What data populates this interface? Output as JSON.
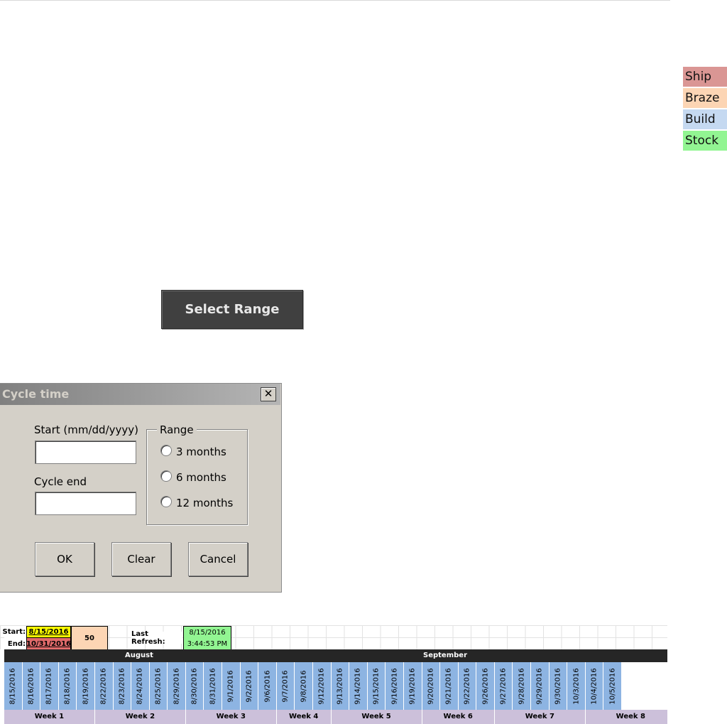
{
  "legend": {
    "items": [
      {
        "label": "Ship",
        "color": "#da9694"
      },
      {
        "label": "Braze",
        "color": "#fcd5b4"
      },
      {
        "label": "Build",
        "color": "#c5d9f1"
      },
      {
        "label": "Stock",
        "color": "#92f592"
      }
    ]
  },
  "select_range_button": {
    "label": "Select Range"
  },
  "dialog": {
    "title": "Cycle time",
    "close_label": "✕",
    "start_label": "Start (mm/dd/yyyy)",
    "start_value": "",
    "cycle_end_label": "Cycle end",
    "cycle_end_value": "",
    "range_group_label": "Range",
    "range_options": [
      "3 months",
      "6 months",
      "12 months"
    ],
    "ok_label": "OK",
    "clear_label": "Clear",
    "cancel_label": "Cancel"
  },
  "sheet": {
    "start_label": "Start:",
    "start_value": "8/15/2016",
    "end_label": "End:",
    "end_value": "10/31/2016",
    "count_value": "50",
    "last_refresh_label": "Last Refresh:",
    "last_refresh_date": "8/15/2016",
    "last_refresh_time": "3:44:53 PM",
    "colors": {
      "start": "#ffff00",
      "end": "#e26b6b",
      "count": "#fcd5b4",
      "refresh": "#92f592",
      "day": "#8db4e2",
      "week": "#ccc0da"
    },
    "months": [
      "August",
      "September"
    ],
    "dates": [
      "8/15/2016",
      "8/16/2016",
      "8/17/2016",
      "8/18/2016",
      "8/19/2016",
      "8/22/2016",
      "8/23/2016",
      "8/24/2016",
      "8/25/2016",
      "8/29/2016",
      "8/30/2016",
      "8/31/2016",
      "9/1/2016",
      "9/2/2016",
      "9/6/2016",
      "9/7/2016",
      "9/8/2016",
      "9/12/2016",
      "9/13/2016",
      "9/14/2016",
      "9/15/2016",
      "9/16/2016",
      "9/19/2016",
      "9/20/2016",
      "9/21/2016",
      "9/22/2016",
      "9/26/2016",
      "9/27/2016",
      "9/28/2016",
      "9/29/2016",
      "9/30/2016",
      "10/3/2016",
      "10/4/2016",
      "10/5/2016"
    ],
    "weeks": [
      "Week 1",
      "Week 2",
      "Week 3",
      "Week 4",
      "Week 5",
      "Week 6",
      "Week 7",
      "Week 8"
    ]
  }
}
